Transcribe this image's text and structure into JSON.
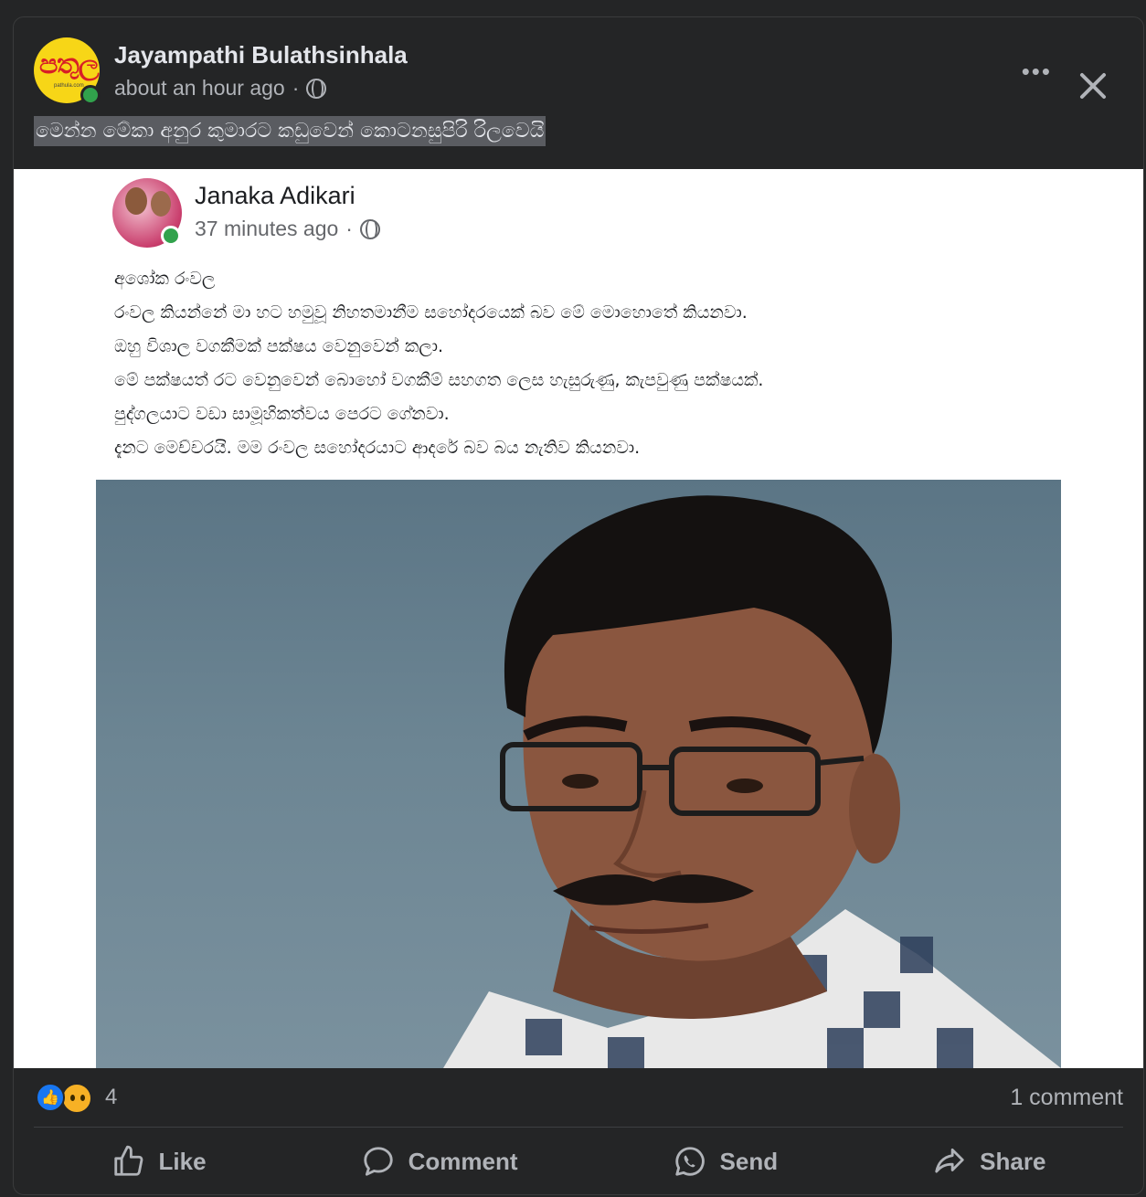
{
  "post": {
    "author": "Jayampathi Bulathsinhala",
    "time": "about an hour ago",
    "separator": "·",
    "caption": "මෙන්න මේකා අනුර කුමාරට කඩුවෙන් කොටනසුපිරි රිලවෙයි",
    "avatar_text": "පතුල",
    "avatar_subtext": "pathula.com"
  },
  "shared": {
    "author": "Janaka Adikari",
    "time": "37 minutes ago",
    "separator": "·",
    "lines": [
      "අශෝක රංවල",
      "රංවල කියන්නේ මා හට හමුවූ නිහතමානීම සහෝදරයෙක් බව මේ මොහොතේ කියනවා.",
      "ඔහු විශාල වගකීමක් පක්ෂය වෙනුවෙන් කලා.",
      "මේ පක්ෂයත් රට වෙනුවෙන් බොහෝ වගකීම් සහගත ලෙස හැසුරුණු, කැපවුණු පක්ෂයක්.",
      "පුද්ගලයාට වඩා සාමූහිකත්වය පෙරට ගේනවා.",
      "දැනට මෙච්චරයි. මම රංවල සහෝදරයාට ආදරේ බව බය නැතිව කියනවා."
    ]
  },
  "stats": {
    "reaction_count": "4",
    "comments": "1 comment"
  },
  "actions": {
    "like": "Like",
    "comment": "Comment",
    "send": "Send",
    "share": "Share"
  },
  "icons": {
    "reactions": [
      "like-icon",
      "sad-icon"
    ],
    "close": "close-icon",
    "more": "more-options-icon",
    "privacy": "globe-icon"
  },
  "colors": {
    "background": "#242526",
    "online": "#31a24c",
    "like_blue": "#1877f2",
    "sad_yellow": "#f7b125",
    "muted_text": "#b0b3b8"
  }
}
